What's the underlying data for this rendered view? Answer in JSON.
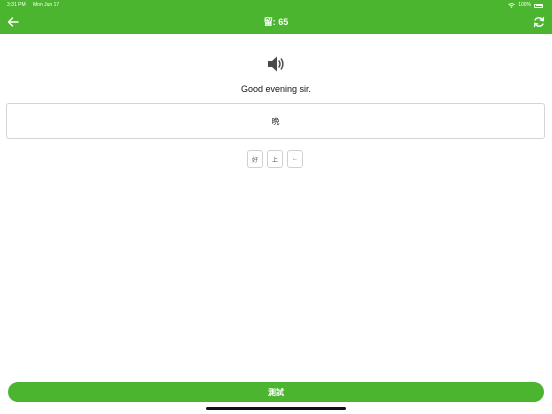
{
  "status_bar": {
    "time": "3:31 PM",
    "date": "Mon Jun 17",
    "battery": "100%",
    "wifi_icon": "wifi-icon",
    "battery_icon": "battery-icon"
  },
  "nav": {
    "title": "留: 65",
    "back_icon": "arrow-left-icon",
    "sync_icon": "sync-icon"
  },
  "main": {
    "speaker_icon": "speaker-icon",
    "prompt": "Good evening sir.",
    "answer": "晩",
    "choices": [
      "好",
      "上",
      "←"
    ]
  },
  "footer": {
    "test_button": "測試"
  },
  "colors": {
    "accent": "#4cb52f",
    "background": "#ffffff",
    "border": "#d4d4d4"
  }
}
